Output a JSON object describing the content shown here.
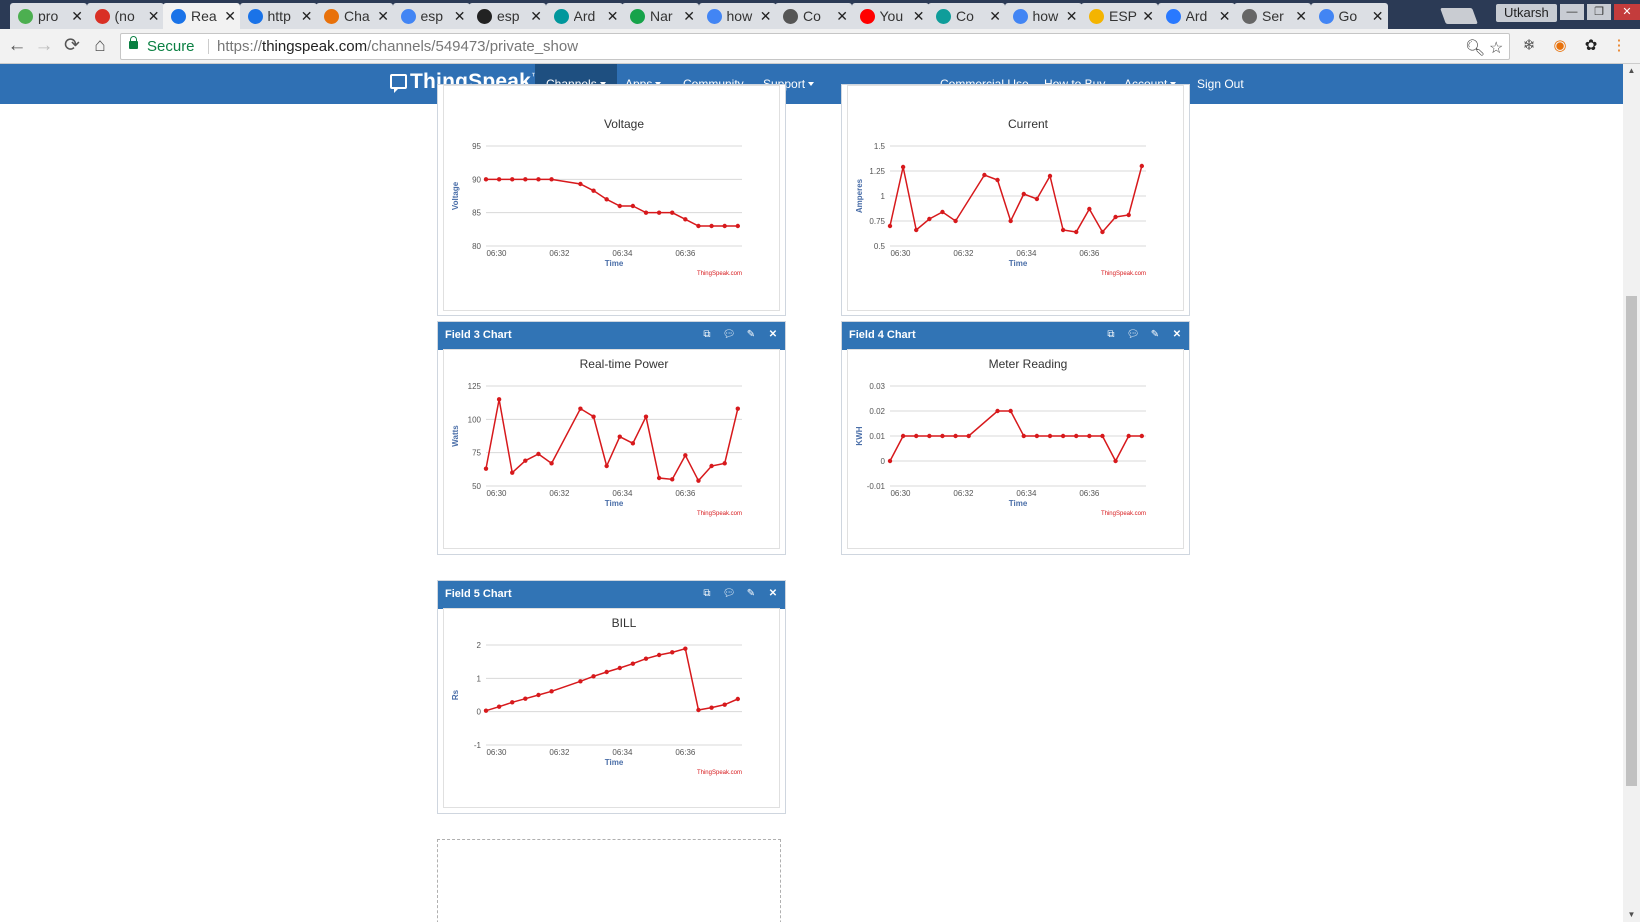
{
  "browser": {
    "tabs": [
      {
        "title": "pro",
        "icon": "spotify-icon",
        "color": "#4caf50"
      },
      {
        "title": "(no",
        "icon": "gmail-icon",
        "color": "#d93025"
      },
      {
        "title": "Rea",
        "icon": "chat-icon",
        "color": "#1a73e8",
        "active": true
      },
      {
        "title": "http",
        "icon": "chat-icon",
        "color": "#1a73e8"
      },
      {
        "title": "Cha",
        "icon": "matlab-icon",
        "color": "#e8710a"
      },
      {
        "title": "esp",
        "icon": "google-icon",
        "color": "#4285f4"
      },
      {
        "title": "esp",
        "icon": "instructables-icon",
        "color": "#222222"
      },
      {
        "title": "Ard",
        "icon": "arduino-icon",
        "color": "#00979c"
      },
      {
        "title": "Nar",
        "icon": "b-icon",
        "color": "#16a34a"
      },
      {
        "title": "how",
        "icon": "google-icon",
        "color": "#4285f4"
      },
      {
        "title": "Co",
        "icon": "vanshika-icon",
        "color": "#555555"
      },
      {
        "title": "You",
        "icon": "youtube-icon",
        "color": "#ff0000"
      },
      {
        "title": "Co",
        "icon": "e-icon",
        "color": "#0f9d9a"
      },
      {
        "title": "how",
        "icon": "google-icon",
        "color": "#4285f4"
      },
      {
        "title": "ESP",
        "icon": "emoji-icon",
        "color": "#f4b400"
      },
      {
        "title": "Ard",
        "icon": "cloud-icon",
        "color": "#2979ff"
      },
      {
        "title": "Ser",
        "icon": "mail-icon",
        "color": "#666666"
      },
      {
        "title": "Go",
        "icon": "google-icon",
        "color": "#4285f4"
      }
    ],
    "profile_name": "Utkarsh",
    "secure_label": "Secure",
    "url_scheme": "https://",
    "url_host": "thingspeak.com",
    "url_path": "/channels/549473/private_show"
  },
  "nav": {
    "brand": "ThingSpeak",
    "trademark": "™",
    "left_items": [
      "Channels",
      "Apps",
      "Community",
      "Support"
    ],
    "right_items": [
      "Commercial Use",
      "How to Buy",
      "Account",
      "Sign Out"
    ]
  },
  "panels": {
    "field3_title": "Field 3 Chart",
    "field4_title": "Field 4 Chart",
    "field5_title": "Field 5 Chart"
  },
  "chart_data": [
    {
      "type": "line",
      "title": "Voltage",
      "xlabel": "Time",
      "ylabel": "Voltage",
      "credit": "ThingSpeak.com",
      "ylim": [
        80,
        95
      ],
      "yticks": [
        95,
        90,
        85,
        80
      ],
      "xticks": [
        "06:30",
        "06:32",
        "06:34",
        "06:36"
      ],
      "x": [
        "06:29:40",
        "06:30:05",
        "06:30:30",
        "06:30:55",
        "06:31:20",
        "06:31:45",
        "06:32:40",
        "06:33:05",
        "06:33:30",
        "06:33:55",
        "06:34:20",
        "06:34:45",
        "06:35:10",
        "06:35:35",
        "06:36:00",
        "06:36:25",
        "06:36:50",
        "06:37:15",
        "06:37:40"
      ],
      "values": [
        90,
        90,
        90,
        90,
        90,
        90,
        89.3,
        88.3,
        87,
        86,
        86,
        85,
        85,
        85,
        84,
        83,
        83,
        83,
        83
      ],
      "color": "#d7191c"
    },
    {
      "type": "line",
      "title": "Current",
      "xlabel": "Time",
      "ylabel": "Amperes",
      "credit": "ThingSpeak.com",
      "ylim": [
        0.5,
        1.5
      ],
      "yticks": [
        "1.5",
        "1.25",
        "1",
        "0.75",
        "0.5"
      ],
      "xticks": [
        "06:30",
        "06:32",
        "06:34",
        "06:36"
      ],
      "x": [
        "06:29:40",
        "06:30:05",
        "06:30:30",
        "06:30:55",
        "06:31:20",
        "06:31:45",
        "06:32:40",
        "06:33:05",
        "06:33:30",
        "06:33:55",
        "06:34:20",
        "06:34:45",
        "06:35:10",
        "06:35:35",
        "06:36:00",
        "06:36:25",
        "06:36:50",
        "06:37:15",
        "06:37:40"
      ],
      "values": [
        0.7,
        1.29,
        0.66,
        0.77,
        0.84,
        0.75,
        1.21,
        1.16,
        0.75,
        1.02,
        0.97,
        1.2,
        0.66,
        0.64,
        0.87,
        0.64,
        0.79,
        0.81,
        1.3
      ],
      "color": "#d7191c"
    },
    {
      "type": "line",
      "title": "Real-time Power",
      "xlabel": "Time",
      "ylabel": "Watts",
      "credit": "ThingSpeak.com",
      "ylim": [
        50,
        125
      ],
      "yticks": [
        125,
        100,
        75,
        50
      ],
      "xticks": [
        "06:30",
        "06:32",
        "06:34",
        "06:36"
      ],
      "x": [
        "06:29:40",
        "06:30:05",
        "06:30:30",
        "06:30:55",
        "06:31:20",
        "06:31:45",
        "06:32:40",
        "06:33:05",
        "06:33:30",
        "06:33:55",
        "06:34:20",
        "06:34:45",
        "06:35:10",
        "06:35:35",
        "06:36:00",
        "06:36:25",
        "06:36:50",
        "06:37:15",
        "06:37:40"
      ],
      "values": [
        63,
        115,
        60,
        69,
        74,
        67,
        108,
        102,
        65,
        87,
        82,
        102,
        56,
        55,
        73,
        54,
        65,
        67,
        108
      ],
      "color": "#d7191c"
    },
    {
      "type": "line",
      "title": "Meter Reading",
      "xlabel": "Time",
      "ylabel": "KWH",
      "credit": "ThingSpeak.com",
      "ylim": [
        -0.01,
        0.03
      ],
      "yticks": [
        "0.03",
        "0.02",
        "0.01",
        "0",
        "-0.01"
      ],
      "xticks": [
        "06:30",
        "06:32",
        "06:34",
        "06:36"
      ],
      "x": [
        "06:29:40",
        "06:30:05",
        "06:30:30",
        "06:30:55",
        "06:31:20",
        "06:31:45",
        "06:32:10",
        "06:33:05",
        "06:33:30",
        "06:33:55",
        "06:34:20",
        "06:34:45",
        "06:35:10",
        "06:35:35",
        "06:36:00",
        "06:36:25",
        "06:36:50",
        "06:37:15",
        "06:37:40"
      ],
      "values": [
        0,
        0.01,
        0.01,
        0.01,
        0.01,
        0.01,
        0.01,
        0.02,
        0.02,
        0.01,
        0.01,
        0.01,
        0.01,
        0.01,
        0.01,
        0.01,
        0,
        0.01,
        0.01
      ],
      "color": "#d7191c"
    },
    {
      "type": "line",
      "title": "BILL",
      "xlabel": "Time",
      "ylabel": "Rs",
      "credit": "ThingSpeak.com",
      "ylim": [
        -1,
        2
      ],
      "yticks": [
        2,
        1,
        0,
        -1
      ],
      "xticks": [
        "06:30",
        "06:32",
        "06:34",
        "06:36"
      ],
      "x": [
        "06:29:40",
        "06:30:05",
        "06:30:30",
        "06:30:55",
        "06:31:20",
        "06:31:45",
        "06:32:40",
        "06:33:05",
        "06:33:30",
        "06:33:55",
        "06:34:20",
        "06:34:45",
        "06:35:10",
        "06:35:35",
        "06:36:00",
        "06:36:25",
        "06:36:50",
        "06:37:15",
        "06:37:40"
      ],
      "values": [
        0.03,
        0.15,
        0.28,
        0.39,
        0.5,
        0.61,
        0.91,
        1.06,
        1.19,
        1.31,
        1.44,
        1.59,
        1.7,
        1.78,
        1.89,
        0.05,
        0.12,
        0.21,
        0.38
      ],
      "color": "#d7191c"
    }
  ]
}
